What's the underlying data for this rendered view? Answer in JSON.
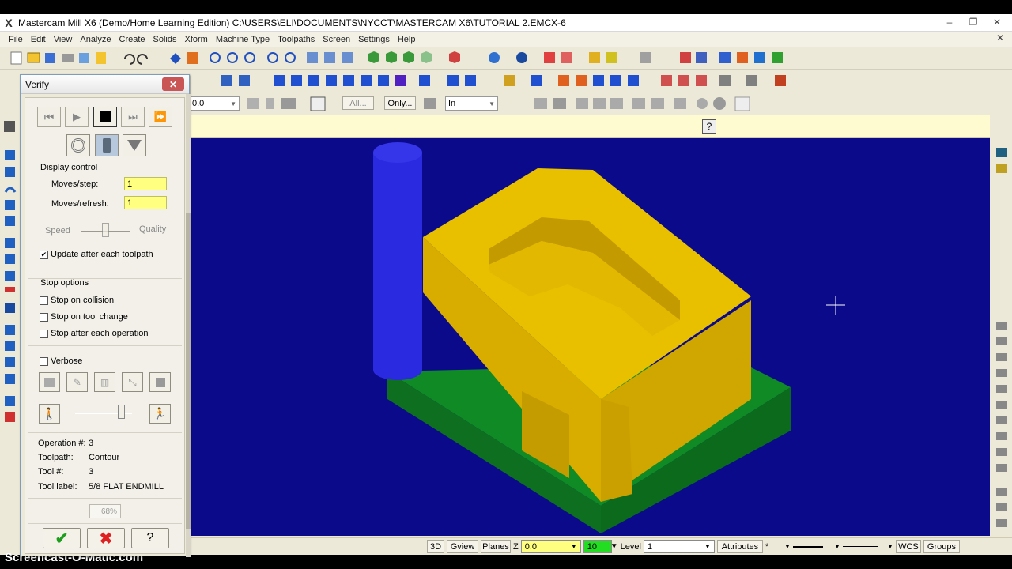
{
  "window": {
    "title": "Mastercam Mill X6 (Demo/Home Learning Edition)  C:\\USERS\\ELI\\DOCUMENTS\\NYCCT\\MASTERCAM X6\\TUTORIAL 2.EMCX-6",
    "logo": "X",
    "minimize": "–",
    "restore": "❐",
    "close": "✕"
  },
  "menu": [
    "File",
    "Edit",
    "View",
    "Analyze",
    "Create",
    "Solids",
    "Xform",
    "Machine Type",
    "Toolpaths",
    "Screen",
    "Settings",
    "Help"
  ],
  "toolbar3": {
    "value_field": "0.0",
    "all_button": "All...",
    "only_button": "Only...",
    "units_select": "In"
  },
  "verify": {
    "title": "Verify",
    "close": "✕",
    "display_control": {
      "group_label": "Display control",
      "moves_step_label": "Moves/step:",
      "moves_step_value": "1",
      "moves_refresh_label": "Moves/refresh:",
      "moves_refresh_value": "1",
      "speed_label": "Speed",
      "quality_label": "Quality",
      "update_label": "Update after each toolpath",
      "update_checked": true
    },
    "stop_options": {
      "group_label": "Stop options",
      "collision_label": "Stop on collision",
      "tool_change_label": "Stop on tool change",
      "after_op_label": "Stop after each operation"
    },
    "verbose_label": "Verbose",
    "info": {
      "operation_label": "Operation #:",
      "operation_value": "3",
      "toolpath_label": "Toolpath:",
      "toolpath_value": "Contour",
      "tool_label": "Tool #:",
      "tool_value": "3",
      "tool_label_label": "Tool label:",
      "tool_label_value": "5/8 FLAT ENDMILL"
    },
    "progress": "68%",
    "colors": {
      "ok": "#1e9e1e",
      "cancel": "#e02020",
      "input_bg": "#ffff80"
    }
  },
  "statusbar": {
    "mode_3d": "3D",
    "gview": "Gview",
    "planes": "Planes",
    "z_label": "Z",
    "z_value": "0.0",
    "color_value": "10",
    "level_label": "Level",
    "level_value": "1",
    "attributes": "Attributes",
    "point_style": "*",
    "wcs": "WCS",
    "groups": "Groups"
  },
  "viewport": {
    "background": "#0a0a8a",
    "stock_color": "#e8c000",
    "base_color": "#0f7a20",
    "tool_color": "#2a2ae0"
  },
  "watermark": "Screencast-O-Matic.com"
}
